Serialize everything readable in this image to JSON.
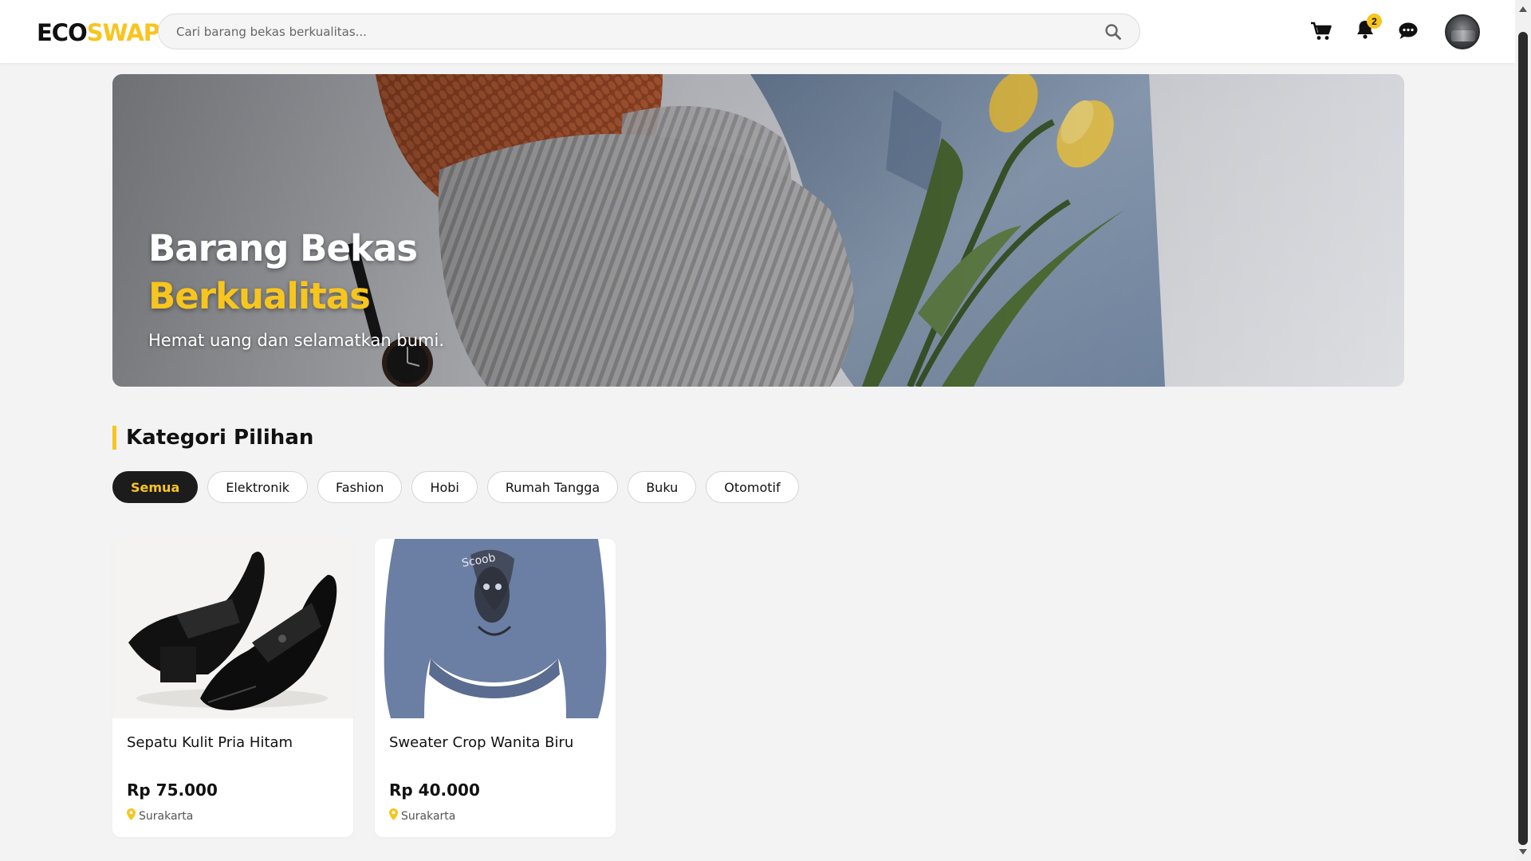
{
  "brand": {
    "eco": "ECO",
    "swap": "SWAP"
  },
  "search": {
    "placeholder": "Cari barang bekas berkualitas..."
  },
  "header": {
    "notification_count": "2"
  },
  "hero": {
    "title_line1": "Barang Bekas",
    "title_line2": "Berkualitas",
    "subtitle": "Hemat uang dan selamatkan bumi."
  },
  "section": {
    "title": "Kategori Pilihan"
  },
  "categories": [
    {
      "label": "Semua",
      "active": true
    },
    {
      "label": "Elektronik",
      "active": false
    },
    {
      "label": "Fashion",
      "active": false
    },
    {
      "label": "Hobi",
      "active": false
    },
    {
      "label": "Rumah Tangga",
      "active": false
    },
    {
      "label": "Buku",
      "active": false
    },
    {
      "label": "Otomotif",
      "active": false
    }
  ],
  "products": [
    {
      "name": "Sepatu Kulit Pria Hitam",
      "price": "Rp 75.000",
      "location": "Surakarta",
      "image": "black-leather-shoes"
    },
    {
      "name": "Sweater Crop Wanita Biru",
      "price": "Rp 40.000",
      "location": "Surakarta",
      "image": "blue-cropped-sweater"
    }
  ],
  "colors": {
    "accent": "#f7c51e",
    "dark": "#1c1c1c",
    "background": "#f3f3f3"
  },
  "icons": [
    "search-icon",
    "cart-icon",
    "bell-icon",
    "chat-icon",
    "map-pin-icon"
  ]
}
